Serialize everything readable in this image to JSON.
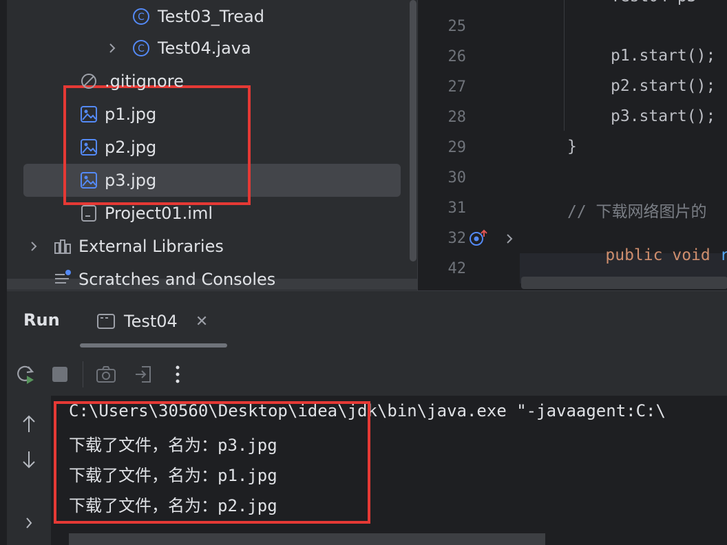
{
  "project_tree": {
    "items": [
      {
        "label": "Test03_Tread",
        "icon": "class-icon"
      },
      {
        "label": "Test04.java",
        "icon": "class-icon"
      },
      {
        "label": ".gitignore",
        "icon": "ignore-file-icon"
      },
      {
        "label": "p1.jpg",
        "icon": "image-file-icon"
      },
      {
        "label": "p2.jpg",
        "icon": "image-file-icon"
      },
      {
        "label": "p3.jpg",
        "icon": "image-file-icon"
      },
      {
        "label": "Project01.iml",
        "icon": "module-file-icon"
      },
      {
        "label": "External Libraries",
        "icon": "libraries-icon"
      },
      {
        "label": "Scratches and Consoles",
        "icon": "scratches-icon"
      }
    ]
  },
  "editor": {
    "line_numbers": [
      "25",
      "26",
      "27",
      "28",
      "29",
      "30",
      "31",
      "32",
      "42"
    ],
    "lines": {
      "l26": "p1.start();",
      "l27": "p2.start();",
      "l28": "p3.start();",
      "l29": "}",
      "l31": "// 下载网络图片的",
      "l32_kw1": "public",
      "l32_kw2": "void",
      "l32_fn": "rur"
    }
  },
  "run": {
    "title": "Run",
    "tab_label": "Test04",
    "console": [
      "C:\\Users\\30560\\Desktop\\idea\\jdk\\bin\\java.exe \"-javaagent:C:\\",
      "下载了文件，名为：p3.jpg",
      "下载了文件，名为：p1.jpg",
      "下载了文件，名为：p2.jpg"
    ]
  },
  "colors": {
    "highlight": "#e53935",
    "accent": "#548af7"
  }
}
